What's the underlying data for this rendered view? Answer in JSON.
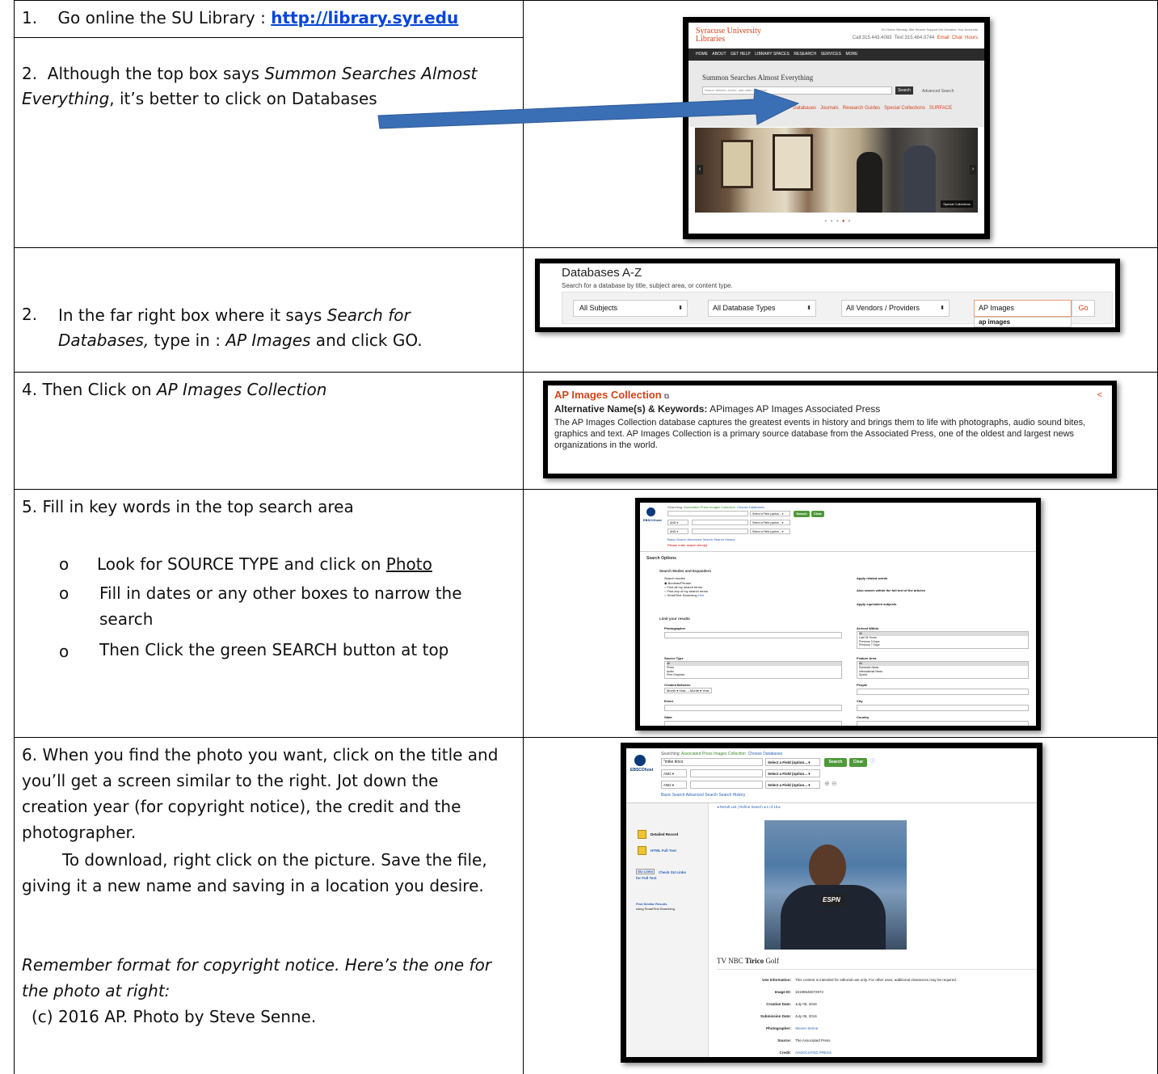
{
  "rows": [
    {
      "step1": "1.    Go online the SU Library : ",
      "step1_link": "http://library.syr.edu",
      "step2_a": "2.  Although the top box says ",
      "step2_em1": "Summon Searches Almost Everything",
      "step2_b": ", it’s better to click on Databases"
    },
    {
      "num": "2.",
      "a": "In the far right box where it says ",
      "em1": "Search for Databases,",
      "b": " type in : ",
      "em2": "AP Images",
      "c": " and click GO."
    },
    {
      "a": "4. Then Click on ",
      "em1": "AP Images Collection"
    },
    {
      "title": "5. Fill in key words in the top search area",
      "bullets": [
        {
          "a": "Look for SOURCE TYPE and click on ",
          "u": "Photo"
        },
        {
          "a": "Fill in dates or any other boxes to narrow the search"
        },
        {
          "a": "Then Click the green SEARCH button at top"
        }
      ],
      "bullet_glyph": "o"
    },
    {
      "p1": "6. When you find the photo you want, click on the title and you’ll get a screen similar to the right. Jot down the creation year (for copyright notice), the credit and the photographer.",
      "p2": "To download, right click on the picture. Save the file, giving it a new name and saving in a location you desire.",
      "p3": "Remember format for copyright notice. Here’s the one for the photo at right:",
      "p4": "(c) 2016 AP.  Photo by Steve Senne."
    }
  ],
  "shot1": {
    "logo1": "Syracuse University",
    "logo2": "Libraries",
    "toplinks": "SU Home  Sitemap  Site Search  Support the Libraries  Your Accounts",
    "call": "Call 315.443.4083",
    "text": "Text 315.464.0744",
    "email": "Email",
    "chat": "Chat",
    "hours": "Hours",
    "nav": [
      "HOME",
      "ABOUT",
      "GET HELP",
      "LIBRARY SPACES",
      "RESEARCH",
      "SERVICES",
      "MORE"
    ],
    "summon": "Summon Searches Almost Everything",
    "search_placeholder": "Search articles, books, and other resources",
    "search_btn": "Search",
    "adv": "Advanced Search",
    "links": [
      "es",
      "Databases",
      "Journals",
      "Research Guides",
      "Special Collections",
      "SURFACE"
    ],
    "badge": "Special Collections",
    "accent": "#d5431b"
  },
  "shot2": {
    "title": "Databases A-Z",
    "sub": "Search for a database by title, subject area, or content type.",
    "sel1": "All Subjects",
    "sel2": "All Database Types",
    "sel3": "All Vendors / Providers",
    "input": "AP Images",
    "go": "Go",
    "suggest": "ap images"
  },
  "shot3": {
    "title": "AP Images Collection",
    "alt_label": "Alternative Name(s) & Keywords:",
    "alt_val": " APimages AP Images Associated Press",
    "desc": "The AP Images Collection database captures the greatest events in history and brings them to life with photographs, audio sound bites, graphics and text. AP Images Collection is a primary source database from the Associated Press, one of the oldest and largest news organizations in the world."
  },
  "shot4": {
    "searching": "Searching:",
    "coll": "Associated Press Images Collection",
    "choose": "Choose Databases",
    "field": "Select a Field (option... ▾",
    "and": "AND ▾",
    "search": "Search",
    "clear": "Clear",
    "basic": "Basic Search   Advanced Search   Search History",
    "enter": "Please enter search term(s).",
    "opts": "Search Options",
    "modes": "Search Modes and Expanders",
    "search_modes": "Search modes",
    "m1": "Boolean/Phrase",
    "m2": "Find all my search terms",
    "m3": "Find any of my search terms",
    "m4": "SmartText Searching",
    "hint": "Hint",
    "r1": "Apply related words",
    "r2": "Also search within the full text of the articles",
    "r3": "Apply equivalent subjects",
    "limit": "Limit your results",
    "photographer": "Photographer",
    "arrived": "Arrived Within",
    "arr_opts": [
      "All",
      "Last 24 Hours",
      "Previous 3 Days",
      "Previous 7 Days"
    ],
    "source": "Source Type",
    "src_opts": [
      "All",
      "Photo",
      "Audio",
      "Print Graphics"
    ],
    "feature": "Feature Area",
    "feat_opts": [
      "All",
      "Domestic News",
      "International News",
      "Sports"
    ],
    "created": "Created Between",
    "created_row": "Month  ▾ Year:      –  Month  ▾ Year:",
    "people": "People",
    "event": "Event",
    "city": "City",
    "state": "State",
    "country": "Country",
    "logo": "EBSCOhost"
  },
  "shot5": {
    "searching": "Searching:",
    "coll": "Associated Press Images Collection",
    "choose": "Choose Databases",
    "query": "\"mike tirico",
    "field": "Select a Field (option... ▾",
    "and": "AND ▾",
    "search": "Search",
    "clear": "Clear",
    "basic": "Basic Search   Advanced Search   Search History",
    "resnav": "◂ Result List  |  Refine Search   ◂  2 of 19  ▸",
    "detailed": "Detailed Record",
    "html": "HTML Full Text",
    "sulinks": "SU Links",
    "check": "Check SU Links",
    "forfull": "for Full Text",
    "similar": "Find Similar Results",
    "smart": "using SmartText Searching.",
    "caption_a": "TV NBC ",
    "caption_b": "Tirico",
    "caption_c": " Golf",
    "use_l": "Use Information:",
    "use_v": "This content is intended for editorial use only. For other uses, additional clearances may be required.",
    "id_l": "Image ID:",
    "id_v": "16198645072972",
    "cd_l": "Creation Date:",
    "cd_v": "July 06, 2016",
    "sd_l": "Submission Date:",
    "sd_v": "July 06, 2016",
    "ph_l": "Photographer:",
    "ph_v": "Steven Senne",
    "so_l": "Source:",
    "so_v": "The Associated Press",
    "cr_l": "Credit:",
    "cr_v": "ASSOCIATED PRESS",
    "espn": "ESPN",
    "logo": "EBSCOhost"
  }
}
